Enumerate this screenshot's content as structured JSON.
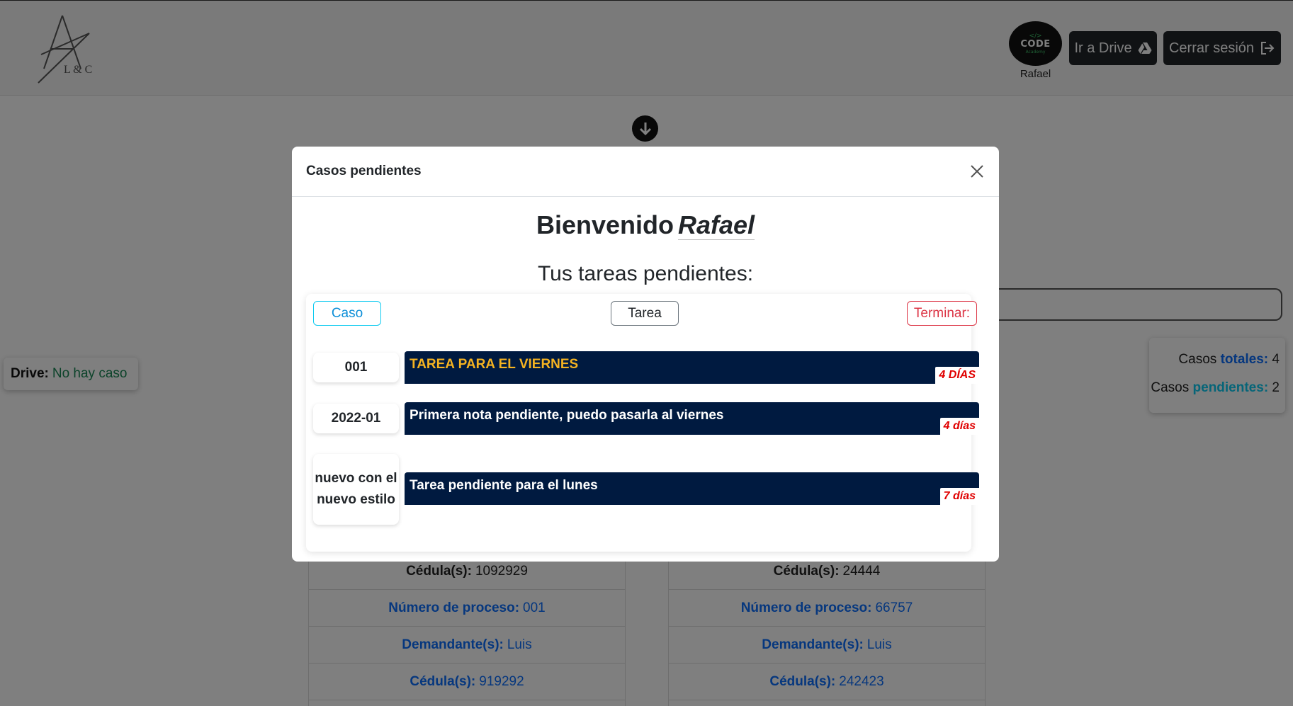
{
  "header": {
    "logo_text": "A L & C",
    "avatar_label": "CODE",
    "avatar_sub": "Academy",
    "user_name": "Rafael",
    "drive_button": "Ir a Drive",
    "logout_button": "Cerrar sesión"
  },
  "background": {
    "drive_status": {
      "label": "Drive:",
      "value": "No hay caso"
    },
    "counts": {
      "total_prefix": "Casos",
      "total_label": "totales:",
      "total_value": "4",
      "pending_prefix": "Casos",
      "pending_label": "pendientes:",
      "pending_value": "2"
    },
    "cards": [
      {
        "rows": [
          {
            "key": "Cédula(s):",
            "value": "1092929"
          },
          {
            "key": "Número de proceso:",
            "value": "001"
          },
          {
            "key": "Demandante(s):",
            "value": "Luis"
          },
          {
            "key": "Cédula(s):",
            "value": "919292"
          }
        ]
      },
      {
        "rows": [
          {
            "key": "Cédula(s):",
            "value": "24444"
          },
          {
            "key": "Número de proceso:",
            "value": "66757"
          },
          {
            "key": "Demandante(s):",
            "value": "Luis"
          },
          {
            "key": "Cédula(s):",
            "value": "242423"
          }
        ]
      }
    ]
  },
  "modal": {
    "title": "Casos pendientes",
    "welcome": "Bienvenido",
    "user": "Rafael",
    "subtitle": "Tus tareas pendientes:",
    "columns": {
      "caso": "Caso",
      "tarea": "Tarea",
      "terminar": "Terminar:"
    },
    "tasks": [
      {
        "case": "001",
        "task": "TAREA PARA EL VIERNES",
        "days": "4 DÍAS"
      },
      {
        "case": "2022-01",
        "task": "Primera nota pendiente, puedo pasarla al viernes",
        "days": "4 días"
      },
      {
        "case": "nuevo con el nuevo estilo",
        "task": "Tarea pendiente para el lunes",
        "days": "7 días"
      }
    ]
  },
  "colors": {
    "primary": "#0d6efd",
    "info": "#0dcaf0",
    "danger": "#dc3545",
    "task_bar": "#001a40",
    "task_highlight": "#f5b321",
    "success": "#198754"
  },
  "icons": {
    "down_arrow": "arrow-down-circle-icon",
    "drive": "google-drive-icon",
    "logout": "box-arrow-right-icon",
    "close": "close-icon"
  }
}
